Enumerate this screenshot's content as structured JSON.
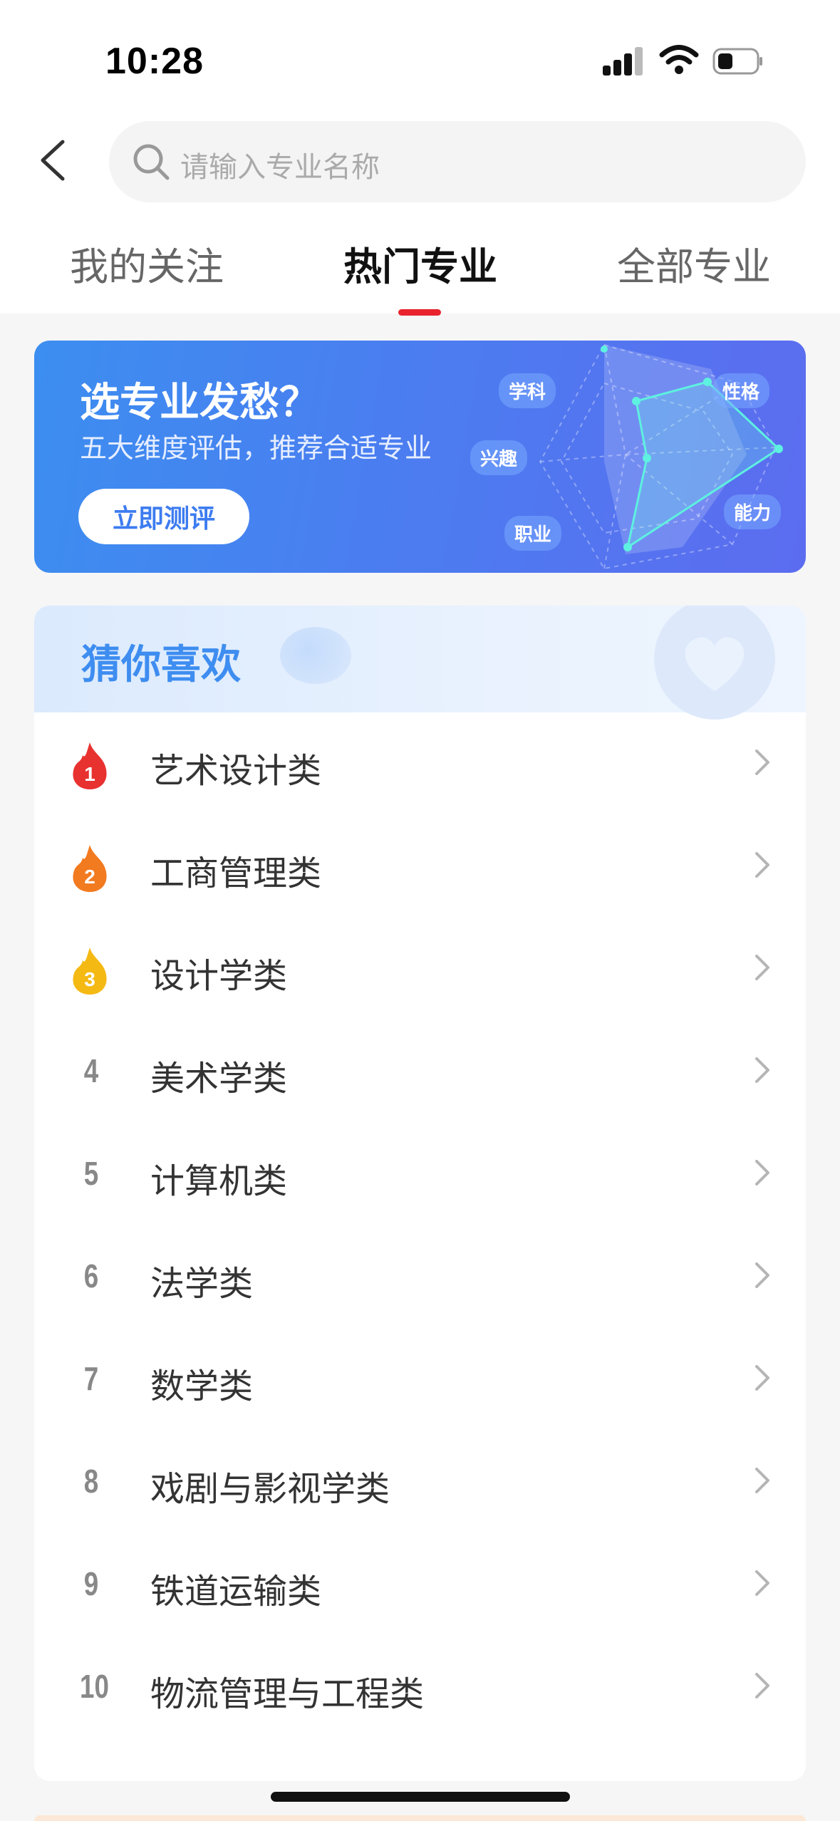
{
  "status_bar": {
    "time": "10:28"
  },
  "header": {
    "search_placeholder": "请输入专业名称",
    "tabs": [
      {
        "label": "我的关注",
        "active": false
      },
      {
        "label": "热门专业",
        "active": true
      },
      {
        "label": "全部专业",
        "active": false
      }
    ],
    "accent_color": "#e8232d"
  },
  "banner": {
    "title": "选专业发愁？",
    "subtitle": "五大维度评估，推荐合适专业",
    "button_label": "立即测评",
    "radar_labels": [
      "学科",
      "性格",
      "兴趣",
      "能力",
      "职业"
    ]
  },
  "card": {
    "title": "猜你喜欢",
    "items": [
      {
        "rank": "1",
        "label": "艺术设计类",
        "badge_color": "#e8322f"
      },
      {
        "rank": "2",
        "label": "工商管理类",
        "badge_color": "#f27a1f"
      },
      {
        "rank": "3",
        "label": "设计学类",
        "badge_color": "#f5b914"
      },
      {
        "rank": "4",
        "label": "美术学类"
      },
      {
        "rank": "5",
        "label": "计算机类"
      },
      {
        "rank": "6",
        "label": "法学类"
      },
      {
        "rank": "7",
        "label": "数学类"
      },
      {
        "rank": "8",
        "label": "戏剧与影视学类"
      },
      {
        "rank": "9",
        "label": "铁道运输类"
      },
      {
        "rank": "10",
        "label": "物流管理与工程类"
      }
    ]
  }
}
